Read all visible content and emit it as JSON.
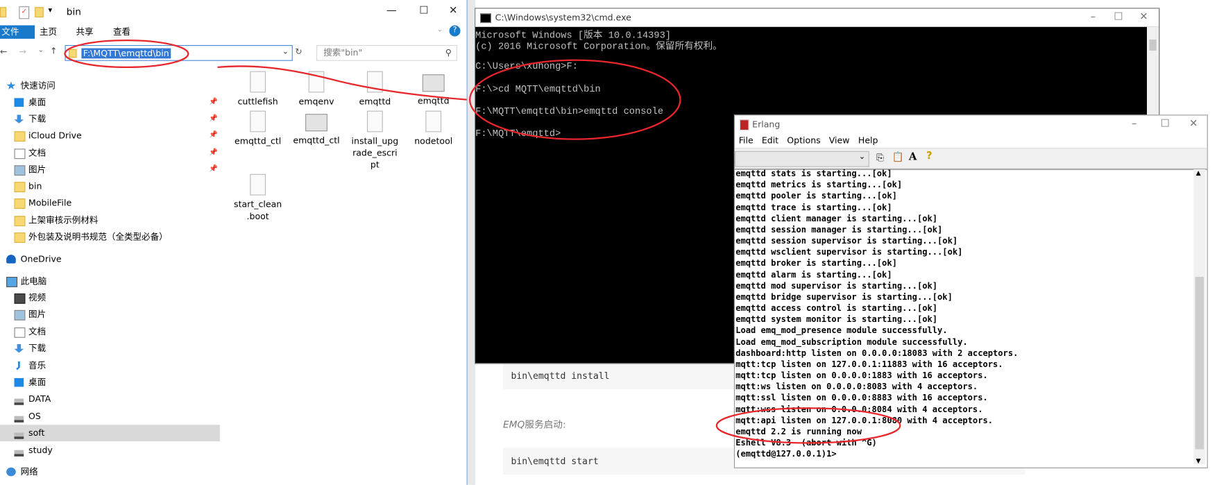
{
  "doc": {
    "code1": "bin\\emqttd install",
    "heading_em": "EMQ",
    "heading_rest": "服务启动:",
    "code2": "bin\\emqttd start"
  },
  "explorer": {
    "title": "bin",
    "tabs": [
      "文件",
      "主页",
      "共享",
      "查看"
    ],
    "address": "F:\\MQTT\\emqttd\\bin",
    "search_placeholder": "搜索\"bin\"",
    "nav": [
      {
        "label": "快速访问",
        "icon": "star-icon"
      },
      {
        "label": "桌面",
        "icon": "desktop-icon",
        "pinned": true
      },
      {
        "label": "下载",
        "icon": "download-icon",
        "pinned": true
      },
      {
        "label": "iCloud Drive",
        "icon": "folder-icon",
        "pinned": true
      },
      {
        "label": "文档",
        "icon": "document-icon",
        "pinned": true
      },
      {
        "label": "图片",
        "icon": "picture-icon",
        "pinned": true
      },
      {
        "label": "bin",
        "icon": "folder-icon"
      },
      {
        "label": "MobileFile",
        "icon": "folder-icon"
      },
      {
        "label": "上架审核示例材料",
        "icon": "folder-icon"
      },
      {
        "label": "外包装及说明书规范（全类型必备）",
        "icon": "folder-icon"
      },
      {
        "label": "OneDrive",
        "icon": "onedrive-icon"
      },
      {
        "label": "此电脑",
        "icon": "computer-icon"
      },
      {
        "label": "视频",
        "icon": "video-icon"
      },
      {
        "label": "图片",
        "icon": "picture-icon"
      },
      {
        "label": "文档",
        "icon": "document-icon"
      },
      {
        "label": "下载",
        "icon": "download-icon"
      },
      {
        "label": "音乐",
        "icon": "music-icon"
      },
      {
        "label": "桌面",
        "icon": "desktop-icon"
      },
      {
        "label": "DATA",
        "icon": "drive-icon"
      },
      {
        "label": "OS",
        "icon": "drive-icon"
      },
      {
        "label": "soft",
        "icon": "drive-icon",
        "selected": true
      },
      {
        "label": "study",
        "icon": "drive-icon"
      },
      {
        "label": "网络",
        "icon": "network-icon"
      }
    ],
    "files": [
      {
        "name": "cuttlefish",
        "type": "file"
      },
      {
        "name": "emqenv",
        "type": "file"
      },
      {
        "name": "emqttd",
        "type": "file"
      },
      {
        "name": "emqttd",
        "type": "app"
      },
      {
        "name": "emqttd_ctl",
        "type": "file"
      },
      {
        "name": "emqttd_ctl",
        "type": "app"
      },
      {
        "name": "install_upg rade_escri pt",
        "type": "file"
      },
      {
        "name": "nodetool",
        "type": "file"
      },
      {
        "name": "start_clean .boot",
        "type": "file"
      }
    ]
  },
  "cmd": {
    "title": "C:\\Windows\\system32\\cmd.exe",
    "lines": [
      "Microsoft Windows [版本 10.0.14393]",
      "(c) 2016 Microsoft Corporation。保留所有权利。",
      "",
      "C:\\Users\\xuhong>F:",
      "",
      "F:\\>cd MQTT\\emqttd\\bin",
      "",
      "F:\\MQTT\\emqttd\\bin>emqttd console",
      "",
      "F:\\MQTT\\emqttd>"
    ]
  },
  "erlang": {
    "title": "Erlang",
    "menu": [
      "File",
      "Edit",
      "Options",
      "View",
      "Help"
    ],
    "lines": [
      "emqttd stats is starting...[ok]",
      "emqttd metrics is starting...[ok]",
      "emqttd pooler is starting...[ok]",
      "emqttd trace is starting...[ok]",
      "emqttd client manager is starting...[ok]",
      "emqttd session manager is starting...[ok]",
      "emqttd session supervisor is starting...[ok]",
      "emqttd wsclient supervisor is starting...[ok]",
      "emqttd broker is starting...[ok]",
      "emqttd alarm is starting...[ok]",
      "emqttd mod supervisor is starting...[ok]",
      "emqttd bridge supervisor is starting...[ok]",
      "emqttd access control is starting...[ok]",
      "emqttd system monitor is starting...[ok]",
      "Load emq_mod_presence module successfully.",
      "Load emq_mod_subscription module successfully.",
      "dashboard:http listen on 0.0.0.0:18083 with 2 acceptors.",
      "mqtt:tcp listen on 127.0.0.1:11883 with 16 acceptors.",
      "mqtt:tcp listen on 0.0.0.0:1883 with 16 acceptors.",
      "mqtt:ws listen on 0.0.0.0:8083 with 4 acceptors.",
      "mqtt:ssl listen on 0.0.0.0:8883 with 16 acceptors.",
      "mqtt:wss listen on 0.0.0.0:8084 with 4 acceptors.",
      "mqtt:api listen on 127.0.0.1:8080 with 4 acceptors.",
      "emqttd 2.2 is running now",
      "Eshell V8.3  (abort with ^G)",
      "(emqttd@127.0.0.1)1>"
    ]
  },
  "colors": {
    "annotation": "#e8262b",
    "accent": "#3378d4"
  }
}
